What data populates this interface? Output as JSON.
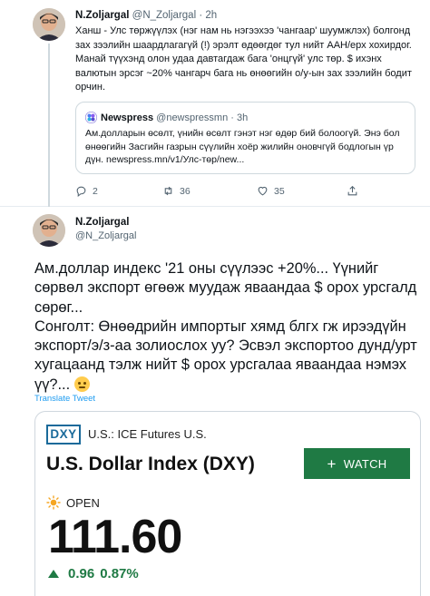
{
  "tweet1": {
    "name": "N.Zoljargal",
    "handle": "@N_Zoljargal",
    "dot": "·",
    "time": "2h",
    "text": "Ханш - Улс төржүүлэх (нэг нам нь нэгээхээ 'чангаар' шуумжлэх) болгонд зах зээлийн шаардлагагүй (!) эрэлт өдөөгдөг тул нийт ААН/ерх хохирдог. Манай түүхэнд олон удаа давтагдаж бага 'онцгүй' улс төр. $ ихэнх валютын эрсэг ~20% чангарч бага нь өнөөгийн о/у-ын зах зээлийн бодит орчин.",
    "quote": {
      "name": "Newspress",
      "handle": "@newspressmn",
      "dot": "·",
      "time": "3h",
      "text": "Ам.долларын өсөлт, үнийн өсөлт гэнэт нэг өдөр бий болоогүй. Энэ бол өнөөгийн Засгийн газрын сүүлийн хоёр жилийн оновчгүй бодлогын үр дүн. newspress.mn/v1/Улс-төр/new..."
    },
    "actions": {
      "reply_count": "2",
      "retweet_count": "36",
      "like_count": "35"
    }
  },
  "tweet2": {
    "name": "N.Zoljargal",
    "handle": "@N_Zoljargal",
    "line1": "Ам.доллар индекс '21 оны сүүлээс +20%... Үүнийг сөрвөл экспорт өгөөж муудаж яваандаа $ орох урсгалд сөрөг...",
    "line2": "Сонголт: Өнөөдрийн импортыг хямд блгх гж ирээдүйн экспорт/э/з-аа золиослох уу? Эсвэл экспортоо дунд/урт хугацаанд тэлж нийт $ орох урсгалаа яваандаа нэмэх үү?...",
    "translate": "Translate Tweet"
  },
  "card": {
    "badge": "DXY",
    "exchange": "U.S.: ICE Futures U.S.",
    "title": "U.S. Dollar Index (DXY)",
    "watch_label": "WATCH",
    "watch_plus": "+",
    "open_label": "OPEN",
    "price": "111.60",
    "change": "0.96",
    "change_pct": "0.87%"
  },
  "colors": {
    "link": "#1d9bf0",
    "watch_bg": "#1f7a44",
    "badge": "#1a6a9a",
    "muted": "#536471"
  }
}
